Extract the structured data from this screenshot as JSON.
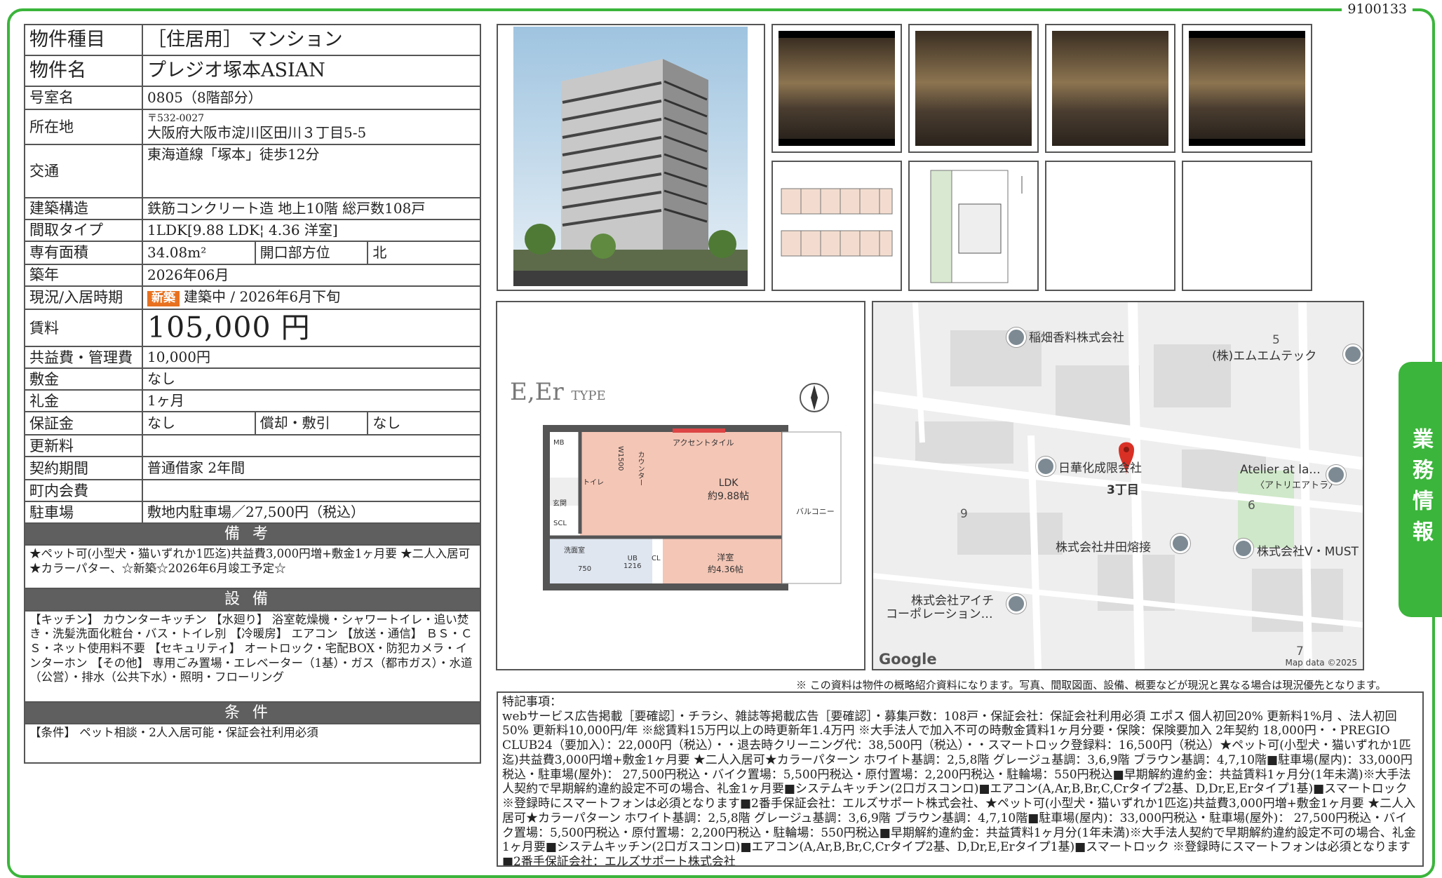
{
  "doc_id": "9100133",
  "table": {
    "rows": [
      {
        "label": "物件種目",
        "value": "［住居用］ マンション"
      },
      {
        "label": "物件名",
        "value": "プレジオ塚本ASIAN"
      },
      {
        "label": "号室名",
        "value": "0805（8階部分）"
      },
      {
        "label": "所在地",
        "zip": "〒532-0027",
        "value": "大阪府大阪市淀川区田川３丁目5-5"
      },
      {
        "label": "交通",
        "value": "東海道線「塚本」徒歩12分"
      },
      {
        "label": "建築構造",
        "value": "鉄筋コンクリート造 地上10階 総戸数108戸"
      },
      {
        "label": "間取タイプ",
        "value": "1LDK[9.88 LDK¦ 4.36 洋室]"
      },
      {
        "label": "専有面積",
        "value": "34.08m²",
        "label2": "開口部方位",
        "value2": "北"
      },
      {
        "label": "築年",
        "value": "2026年06月"
      },
      {
        "label": "現況/入居時期",
        "badge": "新築",
        "value": "建築中 / 2026年6月下旬"
      },
      {
        "label": "賃料",
        "value": "105,000 円"
      },
      {
        "label": "共益費・管理費",
        "value": "10,000円"
      },
      {
        "label": "敷金",
        "value": "なし"
      },
      {
        "label": "礼金",
        "value": "1ヶ月"
      },
      {
        "label": "保証金",
        "value": "なし",
        "label2": "償却・敷引",
        "value2": "なし"
      },
      {
        "label": "更新料",
        "value": ""
      },
      {
        "label": "契約期間",
        "value": "普通借家 2年間"
      },
      {
        "label": "町内会費",
        "value": ""
      },
      {
        "label": "駐車場",
        "value": "敷地内駐車場／27,500円（税込）"
      }
    ],
    "remarks_header": "備考",
    "remarks": "★ペット可(小型犬・猫いずれか1匹迄)共益費3,000円増+敷金1ヶ月要 ★二人入居可★カラーパター、☆新築☆2026年6月竣工予定☆",
    "equipment_header": "設備",
    "equipment": "【キッチン】 カウンターキッチン 【水廻り】 浴室乾燥機・シャワートイレ・追い焚き・洗髪洗面化粧台・バス・トイレ別 【冷暖房】 エアコン 【放送・通信】 ＢＳ・ＣＳ・ネット使用料不要 【セキュリティ】 オートロック・宅配BOX・防犯カメラ・インターホン 【その他】 専用ごみ置場・エレベーター（1基）・ガス（都市ガス）・水道（公営）・排水（公共下水）・照明・フローリング",
    "conditions_header": "条件",
    "conditions": "【条件】 ペット相談・2人入居可能・保証会社利用必須"
  },
  "floorplan": {
    "type_label": "E,Er",
    "type_suffix": "TYPE",
    "rooms": {
      "ldk": "LDK\n約9.88帖",
      "western": "洋室\n約4.36帖",
      "accent": "アクセントタイル",
      "counter": "カウンター",
      "toilet": "トイレ",
      "entrance": "玄関",
      "washroom": "洗面室",
      "ub": "UB\n1216",
      "balcony": "バルコニー",
      "mb": "MB",
      "scl": "SCL",
      "cl": "CL",
      "w1500": "W1500",
      "w750": "750"
    }
  },
  "map": {
    "labels": [
      "稲畑香料株式会社",
      "(株)エムエムテック",
      "日華化成限会社",
      "Atelier at la...",
      "〈アトリエアトラ〉",
      "株式会社井田熔接",
      "株式会社V・MUST",
      "株式会社アイチ",
      "コーポレーション…",
      "3丁目"
    ],
    "numbers": [
      "5",
      "6",
      "9",
      "7"
    ],
    "google": "Google",
    "attribution": "Map data ©2025"
  },
  "caption": "※ この資料は物件の概略紹介資料になります。写真、間取図面、設備、概要などが現況と異なる場合は現況優先となります。",
  "notes": {
    "title": "特記事項：",
    "body": "webサービス広告掲載［要確認］・チラシ、雑誌等掲載広告［要確認］・募集戸数：108戸・保証会社：保証会社利用必須 エポス 個人初回20% 更新料1%月 、法人初回50% 更新料10,000円/年 ※総賃料15万円以上の時更新年1.4万円 ※大手法人で加入不可の時敷金賃料1ヶ月分要・保険：保険要加入 2年契約 18,000円・・PREGIO CLUB24（要加入）：22,000円（税込）・・退去時クリーニング代：38,500円（税込）・・スマートロック登録料：16,500円（税込）★ペット可(小型犬・猫いずれか1匹迄)共益費3,000円増+敷金1ヶ月要 ★二人入居可★カラーパターン ホワイト基調：2,5,8階 グレージュ基調：3,6,9階 ブラウン基調：4,7,10階■駐車場(屋内)：33,000円税込・駐車場(屋外)： 27,500円税込・バイク置場：5,500円税込・原付置場：2,200円税込・駐輪場：550円税込■早期解約違約金：共益賃料1ヶ月分(1年未満)※大手法人契約で早期解約違約設定不可の場合、礼金1ヶ月要■システムキッチン(2口ガスコンロ)■エアコン(A,Ar,B,Br,C,Crタイプ2基、D,Dr,E,Erタイプ1基)■スマートロック ※登録時にスマートフォンは必須となります■2番手保証会社：エルズサポート株式会社、★ペット可(小型犬・猫いずれか1匹迄)共益費3,000円増+敷金1ヶ月要 ★二人入居可★カラーパターン ホワイト基調：2,5,8階 グレージュ基調：3,6,9階 ブラウン基調：4,7,10階■駐車場(屋内)：33,000円税込・駐車場(屋外)： 27,500円税込・バイク置場：5,500円税込・原付置場：2,200円税込・駐輪場：550円税込■早期解約違約金：共益賃料1ヶ月分(1年未満)※大手法人契約で早期解約違約設定不可の場合、礼金1ヶ月要■システムキッチン(2口ガスコンロ)■エアコン(A,Ar,B,Br,C,Crタイプ2基、D,Dr,E,Erタイプ1基)■スマートロック ※登録時にスマートフォンは必須となります■2番手保証会社：エルズサポート株式会社"
  },
  "side_tab": "業務情報"
}
